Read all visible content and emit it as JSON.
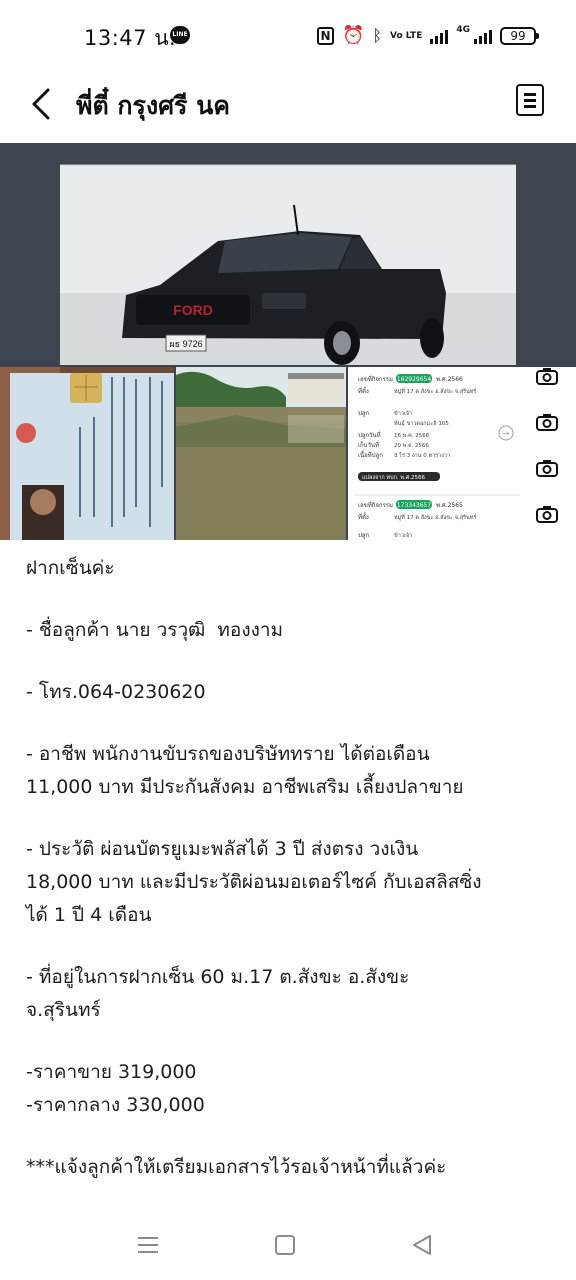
{
  "status_bar": {
    "time": "13:47 น.",
    "line_label": "LINE",
    "volte_label": "Vo LTE",
    "network_label": "4G",
    "battery": "99"
  },
  "header": {
    "title": "พี่ตี๋ กรุงศรี นค"
  },
  "media": {
    "plate_text": "ผธ 9726",
    "grille_text": "FORD",
    "document_rows": [
      {
        "label": "เลขที่กิจกรรม",
        "badge": "162929654",
        "suffix": "พ.ศ.2566"
      },
      {
        "label": "ที่ตั้ง",
        "value": "หมู่ที่ 17 ต.สังขะ อ.สังขะ จ.สุรินทร์"
      },
      {
        "label": "ปลูก",
        "value": "ข้าวเจ้า"
      },
      {
        "label": "",
        "value": "พันธุ์ ขาวดอกมะลิ 105"
      },
      {
        "label": "ปลูกวันที่",
        "value": "16 พ.ค. 2566"
      },
      {
        "label": "เก็บวันที่",
        "value": "20 พ.ย. 2566"
      },
      {
        "label": "เนื้อที่ปลูก",
        "value": "3 ไร่ 3 งาน 0 ตารางวา"
      },
      {
        "label": "",
        "value": "แปลงจาก ทบก. พ.ศ.2566"
      },
      {
        "label": "เลขที่กิจกรรม",
        "badge": "173343657",
        "suffix": "พ.ศ.2565"
      },
      {
        "label": "ที่ตั้ง",
        "value": "หมู่ที่ 17 ต.สังขะ อ.สังขะ จ.สุรินทร์"
      },
      {
        "label": "ปลูก",
        "value": "ข้าวเจ้า"
      }
    ]
  },
  "message": {
    "lines": [
      "ฝากเซ็นค่ะ",
      "",
      "- ชื่อลูกค้า นาย วรวุฒิ  ทองงาม",
      "",
      "- โทร.064-0230620",
      "",
      "- อาชีพ พนักงานขับรถของบริษัททราย ได้ต่อเดือน",
      "11,000 บาท มีประกันสังคม อาชีพเสริม เลี้ยงปลาขาย",
      "",
      "- ประวัติ ผ่อนบัตรยูเมะพลัสได้ 3 ปี ส่งตรง วงเงิน",
      "18,000 บาท และมีประวัติผ่อนมอเตอร์ไซค์ กับเอสลิสซิ่ง",
      "ได้ 1 ปี 4 เดือน",
      "",
      "- ที่อยู่ในการฝากเซ็น 60 ม.17 ต.สังขะ อ.สังขะ",
      "จ.สุรินทร์",
      "",
      "-ราคาขาย 319,000",
      "-ราคากลาง 330,000",
      "",
      "***แจ้งลูกค้าให้เตรียมเอกสารไว้รอเจ้าหน้าที่แล้วค่ะ"
    ]
  },
  "colors": {
    "frame": "#3d4450",
    "badge_green": "#1aa260",
    "text": "#1e1e1e"
  }
}
